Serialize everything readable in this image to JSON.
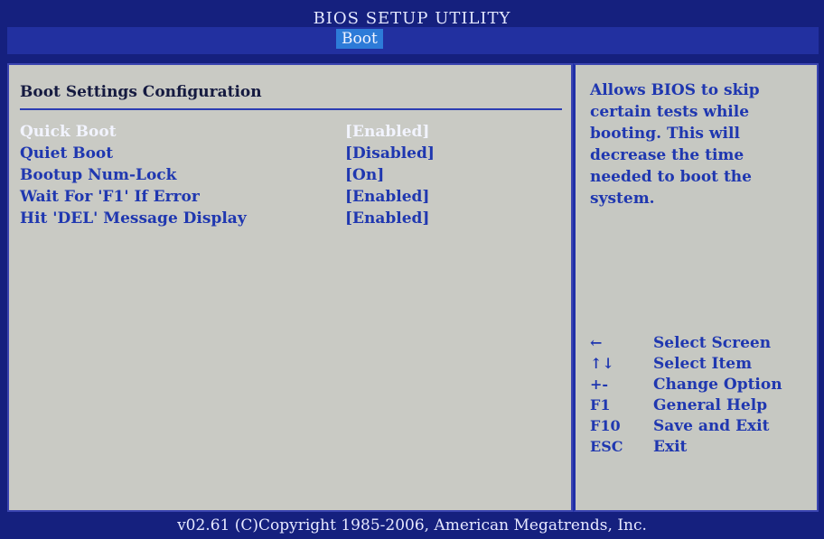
{
  "header": {
    "title": "BIOS SETUP UTILITY",
    "active_tab": "Boot"
  },
  "main": {
    "section_title": "Boot Settings Configuration",
    "settings": [
      {
        "label": "Quick Boot",
        "value": "[Enabled]",
        "selected": true
      },
      {
        "label": "Quiet Boot",
        "value": "[Disabled]",
        "selected": false
      },
      {
        "label": "Bootup Num-Lock",
        "value": "[On]",
        "selected": false
      },
      {
        "label": "Wait For 'F1' If Error",
        "value": "[Enabled]",
        "selected": false
      },
      {
        "label": "Hit 'DEL' Message Display",
        "value": "[Enabled]",
        "selected": false
      }
    ]
  },
  "help": {
    "text": "Allows BIOS to skip\ncertain tests while\nbooting. This will\ndecrease the time\nneeded to boot the\nsystem.",
    "keys": [
      {
        "key": "←",
        "desc": "Select Screen"
      },
      {
        "key": "↑↓",
        "desc": "Select Item"
      },
      {
        "key": "+-",
        "desc": "Change Option"
      },
      {
        "key": "F1",
        "desc": "General Help"
      },
      {
        "key": "F10",
        "desc": "Save and Exit"
      },
      {
        "key": "ESC",
        "desc": "Exit"
      }
    ]
  },
  "footer": {
    "text": "v02.61 (C)Copyright 1985-2006, American Megatrends, Inc."
  },
  "colors": {
    "background": "#15207e",
    "panel": "#c9cac4",
    "text_blue": "#1f37b0",
    "highlight": "#f2f4ff",
    "tab_active": "#2d7bd8"
  }
}
